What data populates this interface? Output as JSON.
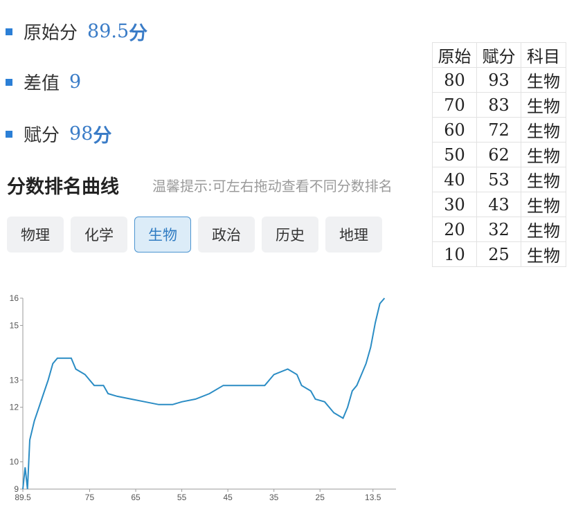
{
  "stats": {
    "raw": {
      "label": "原始分",
      "value": "89.5",
      "unit": "分"
    },
    "diff": {
      "label": "差值",
      "value": "9"
    },
    "scaled": {
      "label": "赋分",
      "value": "98",
      "unit": "分"
    }
  },
  "section": {
    "title": "分数排名曲线",
    "hint": "温馨提示:可左右拖动查看不同分数排名"
  },
  "tabs": [
    {
      "label": "物理",
      "active": false
    },
    {
      "label": "化学",
      "active": false
    },
    {
      "label": "生物",
      "active": true
    },
    {
      "label": "政治",
      "active": false
    },
    {
      "label": "历史",
      "active": false
    },
    {
      "label": "地理",
      "active": false
    }
  ],
  "table": {
    "headers": [
      "原始",
      "赋分",
      "科目"
    ],
    "rows": [
      [
        "80",
        "93",
        "生物"
      ],
      [
        "70",
        "83",
        "生物"
      ],
      [
        "60",
        "72",
        "生物"
      ],
      [
        "50",
        "62",
        "生物"
      ],
      [
        "40",
        "53",
        "生物"
      ],
      [
        "30",
        "43",
        "生物"
      ],
      [
        "20",
        "32",
        "生物"
      ],
      [
        "10",
        "25",
        "生物"
      ]
    ]
  },
  "colors": {
    "accent": "#2b7fd6",
    "line": "#2a8cc4"
  },
  "chart_data": {
    "type": "line",
    "x_ticks": [
      "89.5",
      "75",
      "65",
      "55",
      "45",
      "35",
      "25",
      "13.5"
    ],
    "y_ticks": [
      "9",
      "10",
      "12",
      "13",
      "15",
      "16"
    ],
    "xlim": [
      89.5,
      8.5
    ],
    "ylim": [
      9,
      16
    ],
    "grid": false,
    "series": [
      {
        "x": [
          89.5,
          89,
          88.5,
          88,
          87,
          86,
          85,
          84,
          83,
          82,
          81,
          79,
          78,
          76,
          74,
          72,
          71,
          69,
          66,
          63,
          60,
          57,
          55,
          52,
          49,
          46,
          43,
          40,
          37,
          35,
          32,
          30,
          29,
          27,
          26,
          24,
          22,
          20,
          19,
          18,
          17,
          16,
          15,
          14,
          13,
          12,
          11
        ],
        "y": [
          9,
          9.8,
          9,
          10.8,
          11.5,
          12,
          12.5,
          13,
          13.6,
          13.8,
          13.8,
          13.8,
          13.4,
          13.2,
          12.8,
          12.8,
          12.5,
          12.4,
          12.3,
          12.2,
          12.1,
          12.1,
          12.2,
          12.3,
          12.5,
          12.8,
          12.8,
          12.8,
          12.8,
          13.2,
          13.4,
          13.2,
          12.8,
          12.6,
          12.3,
          12.2,
          11.8,
          11.6,
          12.0,
          12.6,
          12.8,
          13.2,
          13.6,
          14.2,
          15.1,
          15.8,
          16
        ]
      }
    ]
  }
}
